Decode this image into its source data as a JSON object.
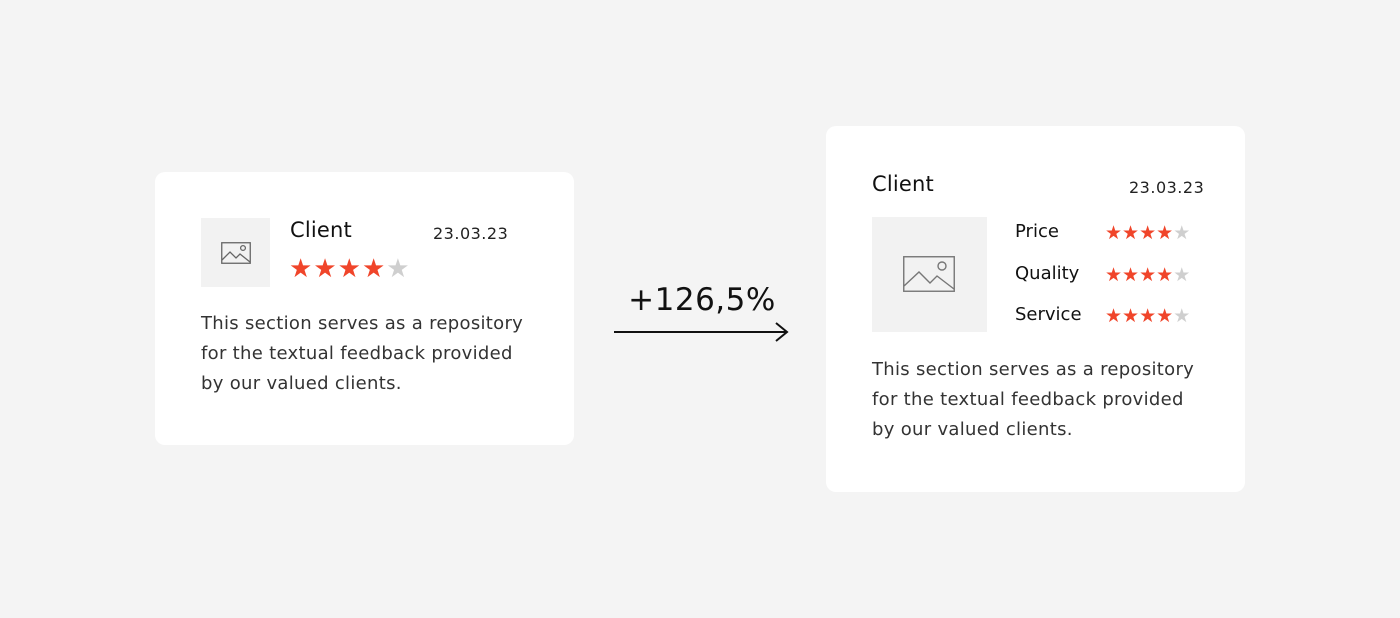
{
  "background_color": "#f4f4f4",
  "accent_color": "#f0452a",
  "before_card": {
    "image_icon": "image-placeholder-icon",
    "client_name": "Client",
    "date": "23.03.23",
    "rating": 4,
    "max_rating": 5,
    "feedback_text": "This section serves as a repository for the textual feedback provided by our valued clients."
  },
  "change": {
    "label": "+126,5%",
    "arrow_icon": "right-arrow-icon"
  },
  "after_card": {
    "image_icon": "image-placeholder-icon",
    "client_name": "Client",
    "date": "23.03.23",
    "ratings": [
      {
        "label": "Price",
        "value": 4,
        "max": 5
      },
      {
        "label": "Quality",
        "value": 4,
        "max": 5
      },
      {
        "label": "Service",
        "value": 4,
        "max": 5
      }
    ],
    "feedback_text": "This section serves as a repository for the textual feedback provided by our valued clients."
  }
}
